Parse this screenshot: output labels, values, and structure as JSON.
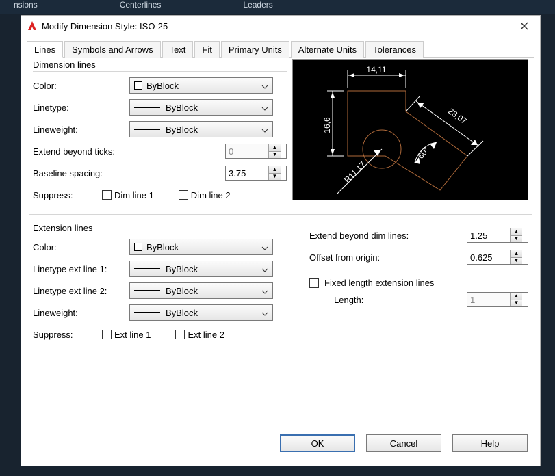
{
  "bg_ribbon": {
    "item1": "nsions",
    "item2": "Centerlines",
    "item3": "Leaders"
  },
  "titlebar": {
    "title": "Modify Dimension Style: ISO-25"
  },
  "tabs": {
    "lines": "Lines",
    "symbols": "Symbols and Arrows",
    "text": "Text",
    "fit": "Fit",
    "primary": "Primary Units",
    "alternate": "Alternate Units",
    "tolerances": "Tolerances"
  },
  "dim_lines": {
    "group": "Dimension lines",
    "color_label": "Color:",
    "color_value": "ByBlock",
    "linetype_label": "Linetype:",
    "linetype_value": "ByBlock",
    "lineweight_label": "Lineweight:",
    "lineweight_value": "ByBlock",
    "extend_ticks_label": "Extend beyond ticks:",
    "extend_ticks_value": "0",
    "baseline_label": "Baseline spacing:",
    "baseline_value": "3.75",
    "suppress_label": "Suppress:",
    "suppress1": "Dim line 1",
    "suppress2": "Dim line 2"
  },
  "ext_lines": {
    "group": "Extension lines",
    "color_label": "Color:",
    "color_value": "ByBlock",
    "ltype1_label": "Linetype ext line 1:",
    "ltype1_value": "ByBlock",
    "ltype2_label": "Linetype ext line 2:",
    "ltype2_value": "ByBlock",
    "lineweight_label": "Lineweight:",
    "lineweight_value": "ByBlock",
    "suppress_label": "Suppress:",
    "suppress1": "Ext line 1",
    "suppress2": "Ext line 2",
    "extend_beyond_label": "Extend beyond dim lines:",
    "extend_beyond_value": "1.25",
    "offset_label": "Offset from origin:",
    "offset_value": "0.625",
    "fixed_len_chk": "Fixed length extension lines",
    "length_label": "Length:",
    "length_value": "1"
  },
  "preview": {
    "d1": "14,11",
    "d2": "16,6",
    "d3": "28,07",
    "ang": "60°",
    "rad": "R11,17"
  },
  "buttons": {
    "ok": "OK",
    "cancel": "Cancel",
    "help": "Help"
  }
}
